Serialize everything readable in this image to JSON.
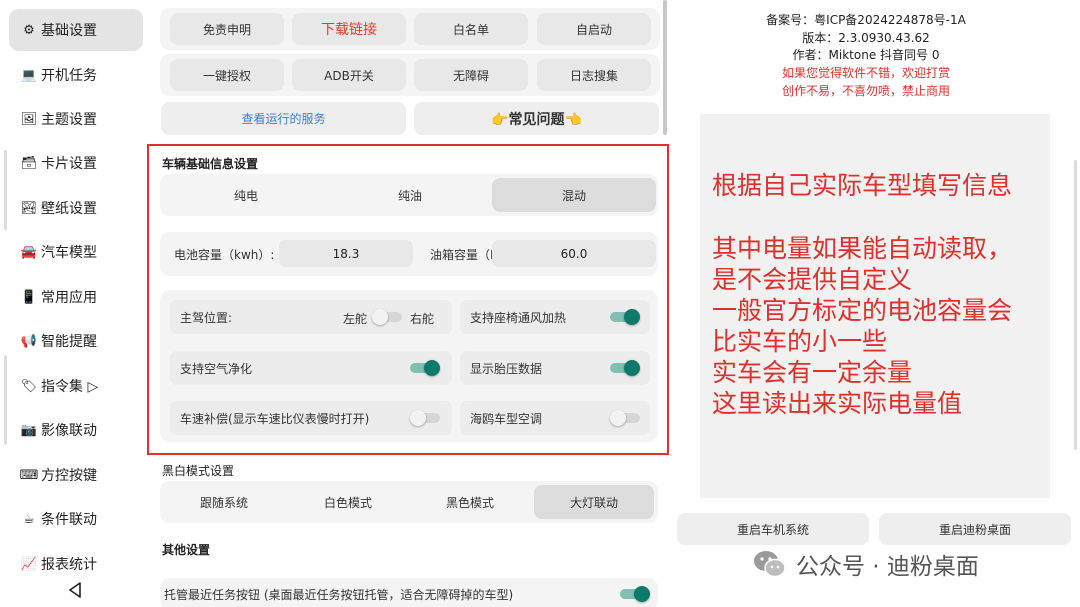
{
  "sidebar": {
    "items": [
      {
        "label": "基础设置",
        "icon": "⚙",
        "icon_name": "gear-icon",
        "active": true
      },
      {
        "label": "开机任务",
        "icon": "💻",
        "icon_name": "laptop-icon",
        "active": false
      },
      {
        "label": "主题设置",
        "icon": "🖼",
        "icon_name": "theme-icon",
        "active": false
      },
      {
        "label": "卡片设置",
        "icon": "🗃",
        "icon_name": "card-box-icon",
        "active": false
      },
      {
        "label": "壁纸设置",
        "icon": "🏞",
        "icon_name": "wallpaper-icon",
        "active": false
      },
      {
        "label": "汽车模型",
        "icon": "🚘",
        "icon_name": "car-icon",
        "active": false
      },
      {
        "label": "常用应用",
        "icon": "📱",
        "icon_name": "phone-icon",
        "active": false
      },
      {
        "label": "智能提醒",
        "icon": "📢",
        "icon_name": "megaphone-icon",
        "active": false
      },
      {
        "label": "指令集 ▷",
        "icon": "🏷",
        "icon_name": "tag-icon",
        "active": false
      },
      {
        "label": "影像联动",
        "icon": "📷",
        "icon_name": "camera-icon",
        "active": false
      },
      {
        "label": "方控按键",
        "icon": "⌨",
        "icon_name": "keyboard-icon",
        "active": false
      },
      {
        "label": "条件联动",
        "icon": "☕",
        "icon_name": "coffee-icon",
        "active": false
      },
      {
        "label": "报表统计",
        "icon": "📈",
        "icon_name": "chart-icon",
        "active": false
      }
    ]
  },
  "top_buttons": {
    "row1": [
      "免责申明",
      "下载链接",
      "白名单",
      "自启动"
    ],
    "row2": [
      "一键授权",
      "ADB开关",
      "无障碍",
      "日志搜集"
    ],
    "row3": [
      "查看运行的服务",
      "👉常见问题👈"
    ]
  },
  "vehicle": {
    "title": "车辆基础信息设置",
    "types": [
      "纯电",
      "纯油",
      "混动"
    ],
    "selected_type": "混动",
    "battery_label": "电池容量（kwh）:",
    "battery_value": "18.3",
    "tank_label": "油箱容量（L）:",
    "tank_value": "60.0",
    "driver_label": "主驾位置:",
    "left_label": "左舵",
    "right_label": "右舵",
    "driver_position": "left",
    "options": [
      {
        "label": "支持座椅通风加热",
        "on": true
      },
      {
        "label": "支持空气净化",
        "on": true
      },
      {
        "label": "显示胎压数据",
        "on": true
      },
      {
        "label": "车速补偿(显示车速比仪表慢时打开)",
        "on": false
      },
      {
        "label": "海鸥车型空调",
        "on": false
      }
    ]
  },
  "bw_mode": {
    "title": "黑白模式设置",
    "options": [
      "跟随系统",
      "白色模式",
      "黑色模式",
      "大灯联动"
    ],
    "selected": "大灯联动"
  },
  "other": {
    "title": "其他设置",
    "row_label": "托管最近任务按钮 (桌面最近任务按钮托管，适合无障碍掉的车型)",
    "row_on": true
  },
  "info": {
    "record": "备案号：粤ICP备2024224878号-1A",
    "version": "版本：2.3.0930.43.62",
    "author": "作者：Miktone  抖音同号 0",
    "tip1": "如果您觉得软件不错，欢迎打赏",
    "tip2": "创作不易，不喜勿喷，禁止商用"
  },
  "annotation": {
    "lines": [
      "根据自己实际车型填写信息",
      "",
      "其中电量如果能自动读取，",
      "是不会提供自定义",
      "一般官方标定的电池容量会",
      "比实车的小一些",
      "实车会有一定余量",
      "这里读出来实际电量值"
    ]
  },
  "actions": {
    "restart_system": "重启车机系统",
    "restart_desktop": "重启迪粉桌面"
  },
  "watermark": {
    "text": "公众号 · 迪粉桌面"
  },
  "colors": {
    "accent_red": "#e0302c",
    "switch_on": "#0e7a6a",
    "link_blue": "#3a7fd0"
  }
}
